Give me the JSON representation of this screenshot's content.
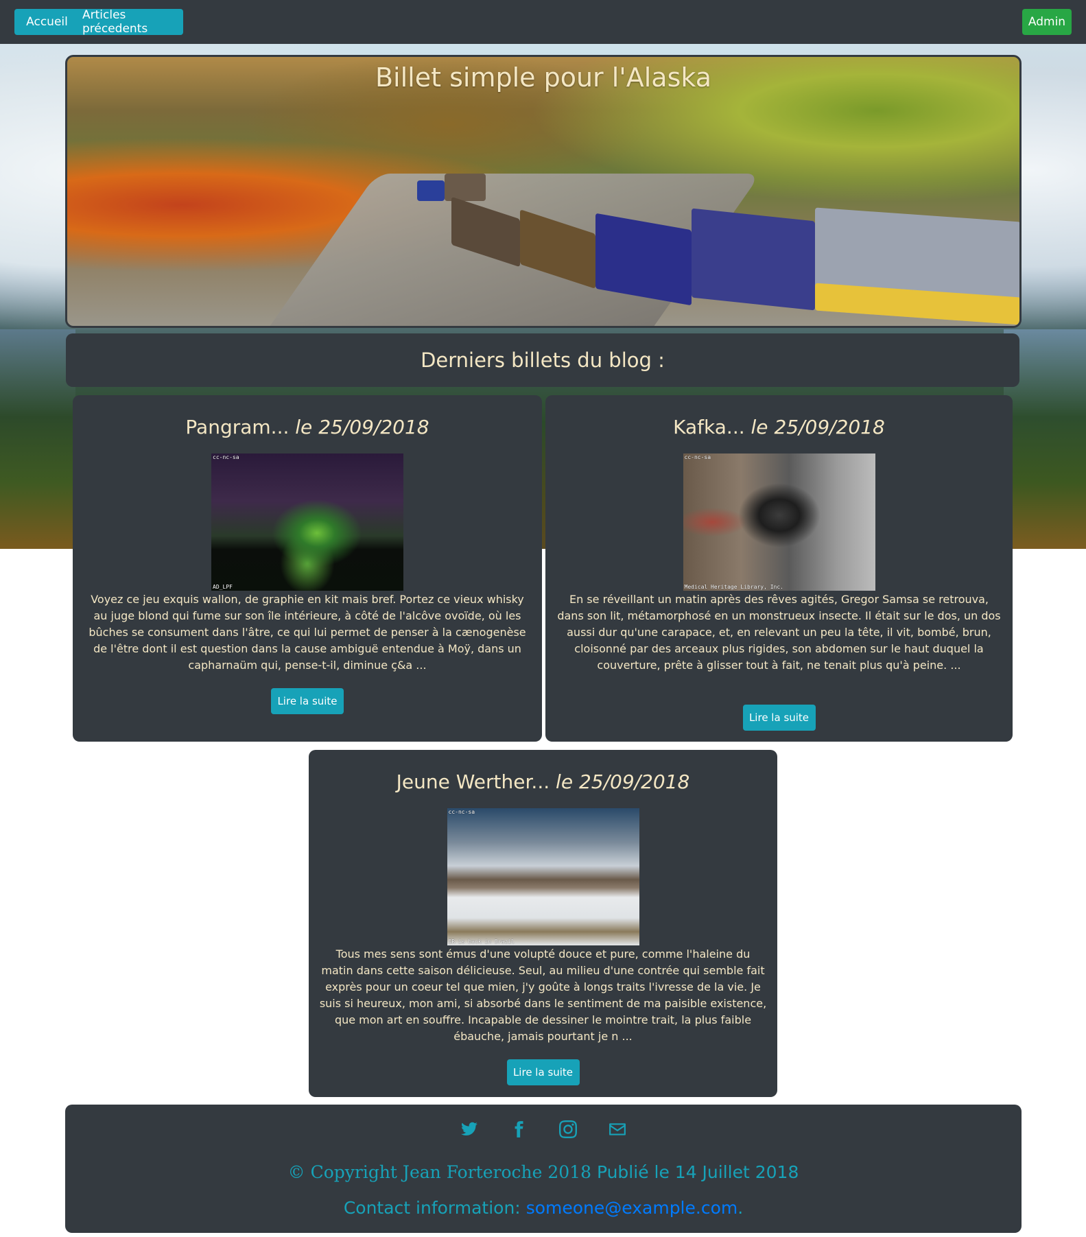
{
  "navbar": {
    "home_label": "Accueil",
    "previous_label": "Articles précedents",
    "admin_label": "Admin"
  },
  "header": {
    "title": "Billet simple pour l'Alaska"
  },
  "section": {
    "title": "Derniers billets du blog :"
  },
  "articles": [
    {
      "title": "Pangram...",
      "date": "le 25/09/2018",
      "image_caption_top": "cc-nc-sa",
      "image_caption_bottom": "AD_LPF",
      "excerpt": "Voyez ce jeu exquis wallon, de graphie en kit mais bref. Portez ce vieux whisky au juge blond qui fume sur son île intérieure, à côté de l'alcôve ovoïde, où les bûches se consument dans l'âtre, ce qui lui permet de penser à la cænogenèse de l'être dont il est question dans la cause ambiguë entendue à Moÿ, dans un capharnaüm qui, pense-t-il, diminue ç&a ...",
      "button_label": "Lire la suite"
    },
    {
      "title": "Kafka...",
      "date": "le 25/09/2018",
      "image_caption_top": "cc-nc-sa",
      "image_caption_bottom": "Medical Heritage Library, Inc.",
      "excerpt": "En se réveillant un matin après des rêves agités, Gregor Samsa se retrouva, dans son lit, métamorphosé en un monstrueux insecte. Il était sur le dos, un dos aussi dur qu'une carapace, et, en relevant un peu la tête, il vit, bombé, brun, cloisonné par des arceaux plus rigides, son abdomen sur le haut duquel la couverture, prête à glisser tout à fait, ne tenait plus qu'à peine. ...",
      "button_label": "Lire la suite"
    },
    {
      "title": "Jeune Werther...",
      "date": "le 25/09/2018",
      "image_caption_top": "cc-nc-sa",
      "image_caption_bottom": "ER is back in Brazil",
      "excerpt": "Tous mes sens sont émus d'une volupté douce et pure, comme l'haleine du matin dans cette saison délicieuse. Seul, au milieu d'une contrée qui semble fait exprès pour un coeur tel que mien, j'y goûte à longs traits l'ivresse de la vie. Je suis si heureux, mon ami, si absorbé dans le sentiment de ma paisible existence, que mon art en souffre. Incapable de dessiner le mointre trait, la plus faible ébauche, jamais pourtant je n ...",
      "button_label": "Lire la suite"
    }
  ],
  "footer": {
    "social_icons": [
      "twitter-icon",
      "facebook-icon",
      "instagram-icon",
      "envelope-icon"
    ],
    "copyright_symbol": "©",
    "copyright_text": "Copyright Jean Forteroche 2018",
    "published_text": "Publié le 14 Juillet 2018",
    "contact_label": "Contact information:",
    "contact_email": "someone@example.com",
    "contact_suffix": "."
  },
  "colors": {
    "navbar_bg": "#343a40",
    "info": "#17a2b8",
    "success": "#28a745",
    "card_bg": "#343a40",
    "card_text": "#f4e7c4",
    "link": "#007bff"
  }
}
